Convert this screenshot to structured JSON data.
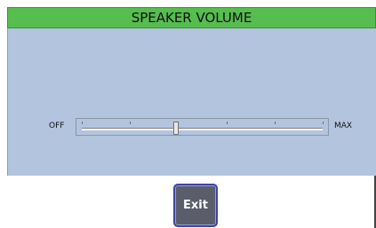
{
  "header": {
    "title": "SPEAKER VOLUME"
  },
  "volume": {
    "min_label": "OFF",
    "max_label": "MAX",
    "level_fraction": 0.39,
    "tick_count": 6
  },
  "actions": {
    "exit_label": "Exit"
  },
  "colors": {
    "title_bar": "#56bd4f",
    "panel": "#b2c4de",
    "exit_button": "#5b5e6a",
    "exit_border": "#3e43a8"
  }
}
